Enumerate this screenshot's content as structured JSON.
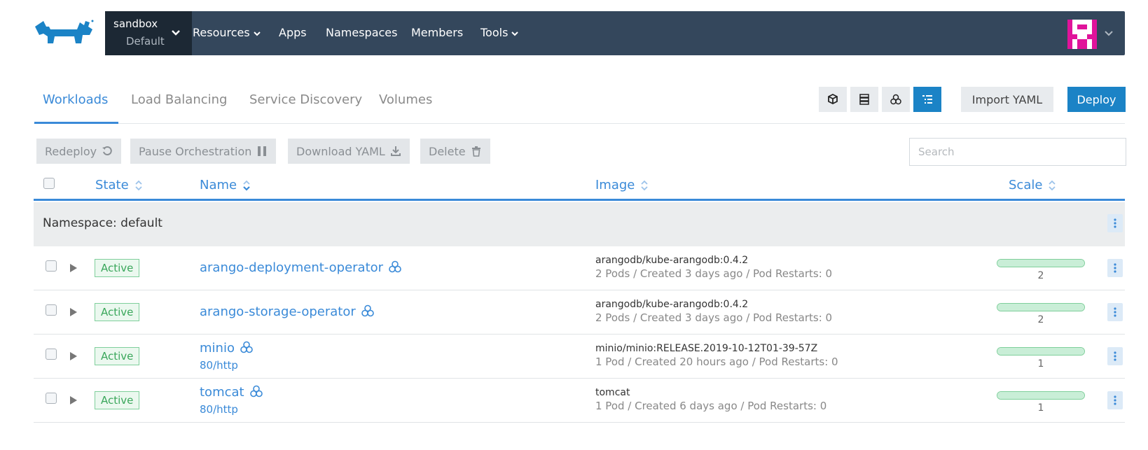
{
  "nav": {
    "cluster_name": "sandbox",
    "project_name": "Default",
    "items": [
      {
        "label": "Resources",
        "has_menu": true
      },
      {
        "label": "Apps",
        "has_menu": false
      },
      {
        "label": "Namespaces",
        "has_menu": false
      },
      {
        "label": "Members",
        "has_menu": false
      },
      {
        "label": "Tools",
        "has_menu": true
      }
    ],
    "avatar_icon": "user-avatar-identicon",
    "colors": {
      "navbar": "#34475c",
      "cluster_bg": "#1c2834",
      "avatar": "#e0139a"
    }
  },
  "tabs": [
    {
      "label": "Workloads",
      "active": true
    },
    {
      "label": "Load Balancing",
      "active": false
    },
    {
      "label": "Service Discovery",
      "active": false
    },
    {
      "label": "Volumes",
      "active": false
    }
  ],
  "view_toggles": [
    {
      "icon": "cube-icon",
      "active": false
    },
    {
      "icon": "server-stack-icon",
      "active": false
    },
    {
      "icon": "workload-cluster-icon",
      "active": false
    },
    {
      "icon": "list-icon",
      "active": true
    }
  ],
  "actions": {
    "import_label": "Import YAML",
    "deploy_label": "Deploy"
  },
  "bulk_actions": [
    {
      "label": "Redeploy",
      "icon": "redeploy-icon"
    },
    {
      "label": "Pause Orchestration",
      "icon": "pause-icon"
    },
    {
      "label": "Download YAML",
      "icon": "download-icon"
    },
    {
      "label": "Delete",
      "icon": "trash-icon"
    }
  ],
  "search": {
    "placeholder": "Search",
    "value": ""
  },
  "table": {
    "columns": [
      {
        "label": "State",
        "sort": "none"
      },
      {
        "label": "Name",
        "sort": "descending"
      },
      {
        "label": "Image",
        "sort": "none"
      },
      {
        "label": "Scale",
        "sort": "none"
      }
    ],
    "group_label": "Namespace: default",
    "rows": [
      {
        "state": "Active",
        "name": "arango-deployment-operator",
        "endpoint": "",
        "image": "arangodb/kube-arangodb:0.4.2",
        "detail": "2 Pods / Created 3 days ago / Pod Restarts: 0",
        "scale": "2",
        "scale_ready_fraction": 1.0
      },
      {
        "state": "Active",
        "name": "arango-storage-operator",
        "endpoint": "",
        "image": "arangodb/kube-arangodb:0.4.2",
        "detail": "2 Pods / Created 3 days ago / Pod Restarts: 0",
        "scale": "2",
        "scale_ready_fraction": 1.0
      },
      {
        "state": "Active",
        "name": "minio",
        "endpoint": "80/http",
        "image": "minio/minio:RELEASE.2019-10-12T01-39-57Z",
        "detail": "1 Pod / Created 20 hours ago / Pod Restarts: 0",
        "scale": "1",
        "scale_ready_fraction": 1.0
      },
      {
        "state": "Active",
        "name": "tomcat",
        "endpoint": "80/http",
        "image": "tomcat",
        "detail": "1 Pod / Created 6 days ago / Pod Restarts: 0",
        "scale": "1",
        "scale_ready_fraction": 1.0
      }
    ]
  },
  "colors": {
    "accent": "#3a8ad8",
    "primary_button": "#1b83c6",
    "active_state": "#3aa75b"
  }
}
